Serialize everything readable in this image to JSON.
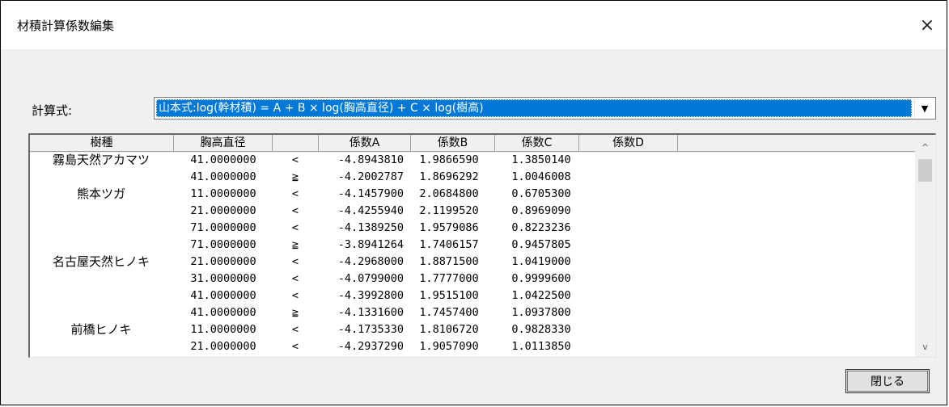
{
  "window": {
    "title": "材積計算係数編集",
    "close_icon": "×"
  },
  "formula": {
    "label": "計算式:",
    "selected": "山本式:log(幹材積) = A + B × log(胸高直径) + C × log(樹高)",
    "dropdown_icon": "▼"
  },
  "grid": {
    "columns": [
      "樹種",
      "胸高直径",
      "",
      "係数A",
      "係数B",
      "係数C",
      "係数D"
    ],
    "rows": [
      {
        "species": "霧島天然アカマツ",
        "dbh": "41.0000000",
        "op": "<",
        "a": "-4.8943810",
        "b": "1.9866590",
        "c": "1.3850140"
      },
      {
        "species": "",
        "dbh": "41.0000000",
        "op": "≧",
        "a": "-4.2002787",
        "b": "1.8696292",
        "c": "1.0046008"
      },
      {
        "species": "熊本ツガ",
        "dbh": "11.0000000",
        "op": "<",
        "a": "-4.1457900",
        "b": "2.0684800",
        "c": "0.6705300"
      },
      {
        "species": "",
        "dbh": "21.0000000",
        "op": "<",
        "a": "-4.4255940",
        "b": "2.1199520",
        "c": "0.8969090"
      },
      {
        "species": "",
        "dbh": "71.0000000",
        "op": "<",
        "a": "-4.1389250",
        "b": "1.9579086",
        "c": "0.8223236"
      },
      {
        "species": "",
        "dbh": "71.0000000",
        "op": "≧",
        "a": "-3.8941264",
        "b": "1.7406157",
        "c": "0.9457805"
      },
      {
        "species": "名古屋天然ヒノキ",
        "dbh": "21.0000000",
        "op": "<",
        "a": "-4.2968000",
        "b": "1.8871500",
        "c": "1.0419000"
      },
      {
        "species": "",
        "dbh": "31.0000000",
        "op": "<",
        "a": "-4.0799000",
        "b": "1.7777000",
        "c": "0.9999600"
      },
      {
        "species": "",
        "dbh": "41.0000000",
        "op": "<",
        "a": "-4.3992800",
        "b": "1.9515100",
        "c": "1.0422500"
      },
      {
        "species": "",
        "dbh": "41.0000000",
        "op": "≧",
        "a": "-4.1331600",
        "b": "1.7457400",
        "c": "1.0937800"
      },
      {
        "species": "前橋ヒノキ",
        "dbh": "11.0000000",
        "op": "<",
        "a": "-4.1735330",
        "b": "1.8106720",
        "c": "0.9828330"
      },
      {
        "species": "",
        "dbh": "21.0000000",
        "op": "<",
        "a": "-4.2937290",
        "b": "1.9057090",
        "c": "1.0113850"
      }
    ],
    "scroll_up_icon": "^",
    "scroll_down_icon": "v"
  },
  "footer": {
    "close_label": "閉じる"
  }
}
